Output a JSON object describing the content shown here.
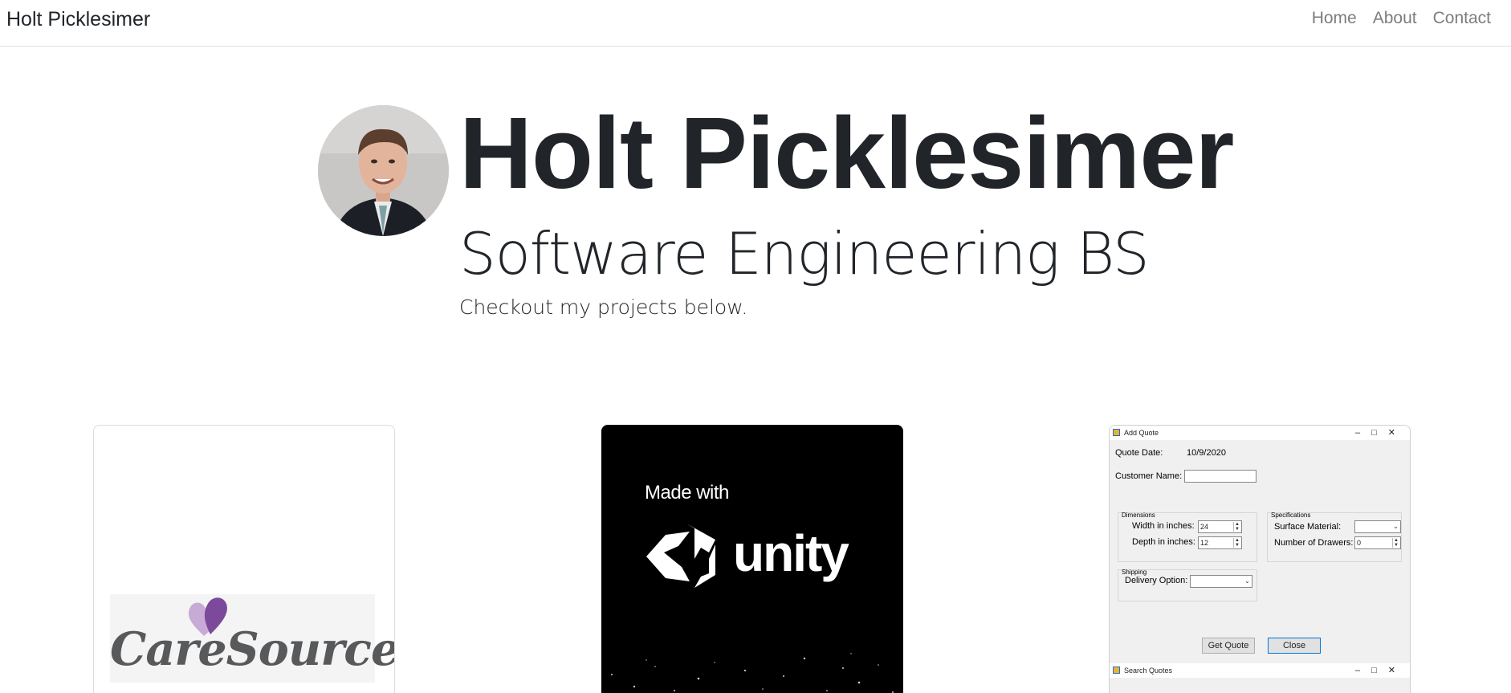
{
  "navbar": {
    "brand": "Holt Picklesimer",
    "links": [
      "Home",
      "About",
      "Contact"
    ]
  },
  "hero": {
    "name": "Holt Picklesimer",
    "subtitle": "Software Engineering BS",
    "tagline": "Checkout my projects below."
  },
  "cards": {
    "caresource": {
      "logo_text": "CareSource"
    },
    "unity": {
      "made_with": "Made with",
      "logo_text": "unity"
    },
    "quote_app": {
      "window_title": "Add Quote",
      "quote_date_label": "Quote Date:",
      "quote_date_value": "10/9/2020",
      "customer_name_label": "Customer Name:",
      "dimensions_group": "Dimensions",
      "width_label": "Width in inches:",
      "width_value": "24",
      "depth_label": "Depth in inches:",
      "depth_value": "12",
      "specifications_group": "Specifications",
      "surface_label": "Surface Material:",
      "drawers_label": "Number of Drawers:",
      "drawers_value": "0",
      "shipping_group": "Shipping",
      "delivery_label": "Delivery Option:",
      "get_quote_button": "Get Quote",
      "close_button": "Close",
      "second_window_title": "Search Quotes"
    }
  },
  "colors": {
    "text": "#212529",
    "nav_link": "#7d7d7d",
    "caresource_purple": "#8e5ba8",
    "unity_bg": "#000000"
  }
}
